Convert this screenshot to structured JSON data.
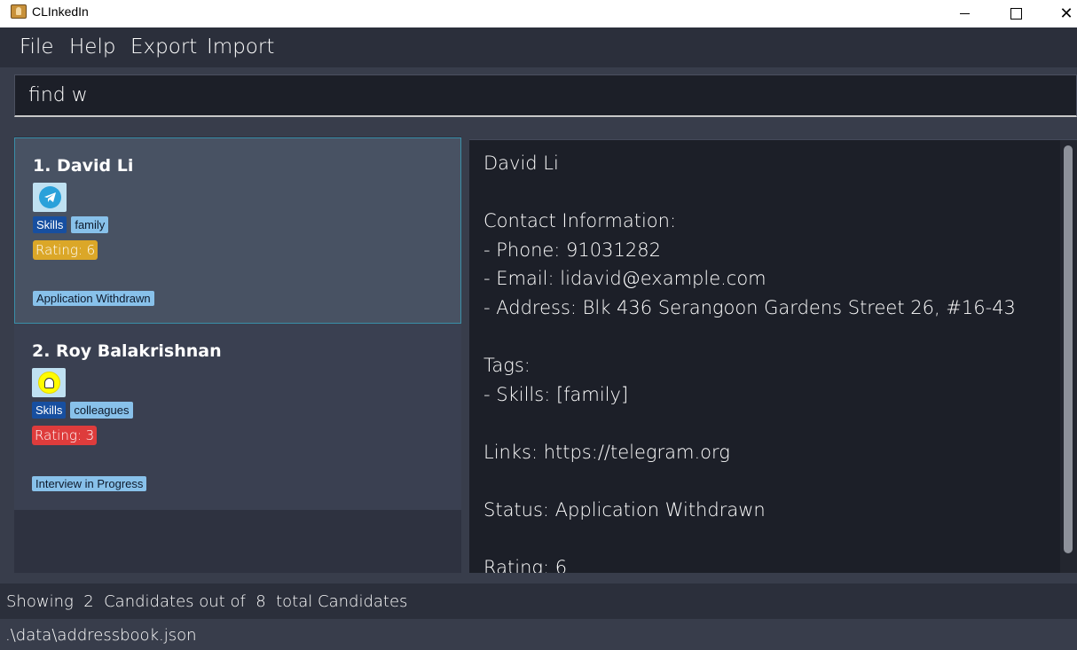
{
  "window": {
    "title": "CLInkedIn"
  },
  "menu": {
    "file": "File",
    "help": "Help",
    "export": "Export",
    "import": "Import"
  },
  "command": {
    "value": "find w"
  },
  "candidates": [
    {
      "index_name": "1.  David Li",
      "link_icon": "telegram-icon",
      "tag_category": "Skills",
      "tag": "family",
      "rating": "Rating: 6",
      "rating_color": "#dba728",
      "status": "Application Withdrawn"
    },
    {
      "index_name": "2.  Roy Balakrishnan",
      "link_icon": "snapchat-icon",
      "tag_category": "Skills",
      "tag": "colleagues",
      "rating": "Rating: 3",
      "rating_color": "#de3c3c",
      "status": "Interview in Progress"
    }
  ],
  "detail": {
    "name": "David Li",
    "contact_header": "Contact Information:",
    "phone": "- Phone: 91031282",
    "email": "- Email: lidavid@example.com",
    "address": "- Address: Blk 436 Serangoon Gardens Street 26, #16-43",
    "tags_header": "Tags:",
    "skills": "- Skills: [family]",
    "links": "Links: https://telegram.org",
    "status": "Status: Application Withdrawn",
    "rating": "Rating: 6"
  },
  "status_bar": {
    "text": "Showing  2  Candidates out of  8  total Candidates"
  },
  "footer": {
    "path": ".\\data\\addressbook.json"
  }
}
